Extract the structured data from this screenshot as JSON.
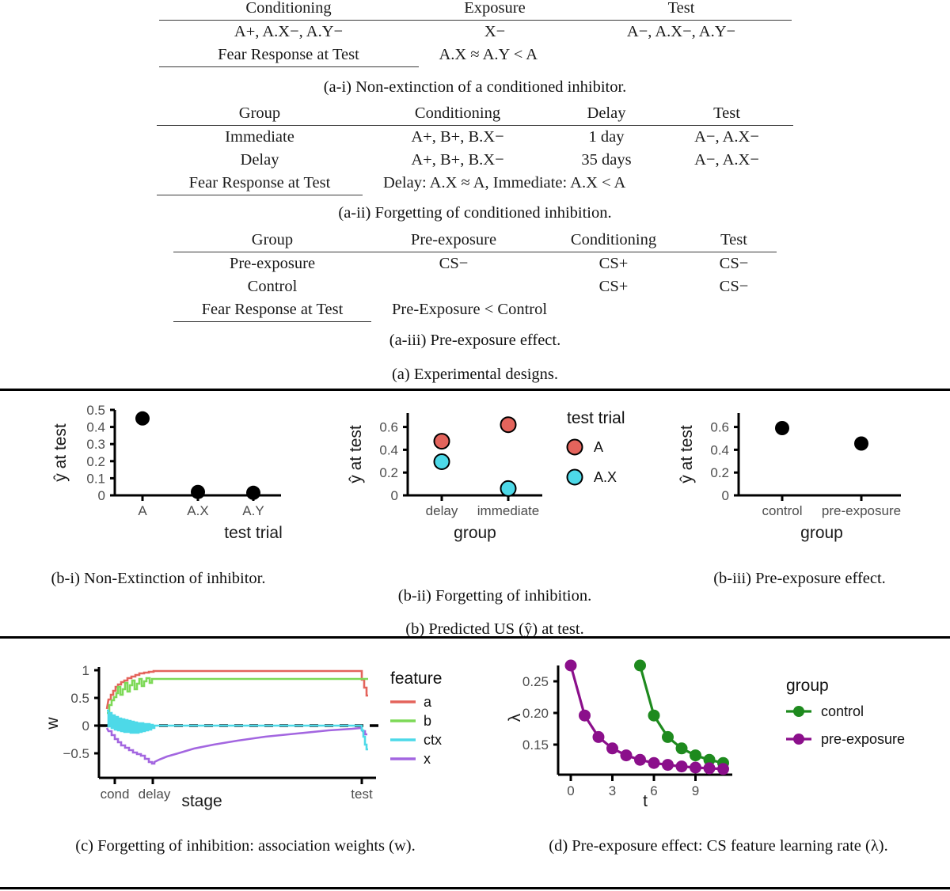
{
  "figure": {
    "sections": {
      "a_caption": "(a) Experimental designs.",
      "b_caption": "(b) Predicted US (ŷ) at test.",
      "c_caption": "(c) Forgetting of inhibition: association weights (w).",
      "d_caption": "(d) Pre-exposure effect: CS feature learning rate (λ)."
    }
  },
  "tables": {
    "a_i": {
      "caption": "(a-i) Non-extinction of a conditioned inhibitor.",
      "headers": [
        "Conditioning",
        "Exposure",
        "Test"
      ],
      "rows": [
        [
          "A+, A.X−, A.Y−",
          "X−",
          "A−, A.X−, A.Y−"
        ]
      ],
      "summary_label": "Fear Response at Test",
      "summary_value": "A.X ≈ A.Y < A"
    },
    "a_ii": {
      "caption": "(a-ii) Forgetting of conditioned inhibition.",
      "headers": [
        "Group",
        "Conditioning",
        "Delay",
        "Test"
      ],
      "rows": [
        [
          "Immediate",
          "A+, B+, B.X−",
          "1 day",
          "A−, A.X−"
        ],
        [
          "Delay",
          "A+, B+, B.X−",
          "35 days",
          "A−, A.X−"
        ]
      ],
      "summary_label": "Fear Response at Test",
      "summary_value": "Delay: A.X ≈ A, Immediate: A.X < A"
    },
    "a_iii": {
      "caption": "(a-iii) Pre-exposure effect.",
      "headers": [
        "Group",
        "Pre-exposure",
        "Conditioning",
        "Test"
      ],
      "rows": [
        [
          "Pre-exposure",
          "CS−",
          "CS+",
          "CS−"
        ],
        [
          "Control",
          "",
          "CS+",
          "CS−"
        ]
      ],
      "summary_label": "Fear Response at Test",
      "summary_value": "Pre-Exposure < Control"
    }
  },
  "captions": {
    "b_i": "(b-i) Non-Extinction of inhibitor.",
    "b_ii": "(b-ii) Forgetting of inhibition.",
    "b_iii": "(b-iii) Pre-exposure effect."
  },
  "colors": {
    "red": "#E4645C",
    "green": "#7DD957",
    "cyan": "#4DD9E8",
    "purple": "#A366E0",
    "dark_green": "#1E8A1E",
    "dark_purple": "#8B0F8B",
    "point_red": "#E4645C",
    "point_cyan": "#4DD9E8",
    "black": "#000000",
    "tick_gray": "#4d4d4d"
  },
  "chart_data": [
    {
      "id": "b-i",
      "type": "scatter",
      "title": "",
      "xlabel": "test trial",
      "ylabel": "ŷ at test",
      "categories": [
        "A",
        "A.X",
        "A.Y"
      ],
      "values": [
        0.45,
        0.02,
        0.015
      ],
      "ylim": [
        0,
        0.52
      ],
      "yticks": [
        0,
        0.1,
        0.2,
        0.3,
        0.4,
        0.5
      ],
      "ytick_labels": [
        "0",
        "0.1",
        "0.2",
        "0.3",
        "0.4",
        "0.5"
      ],
      "grid": false,
      "legend": "none",
      "point_color": "#000000"
    },
    {
      "id": "b-ii",
      "type": "scatter",
      "title": "",
      "xlabel": "group",
      "ylabel": "ŷ at test",
      "categories": [
        "delay",
        "immediate"
      ],
      "series": [
        {
          "name": "A",
          "color": "#E4645C",
          "values": [
            0.475,
            0.62
          ]
        },
        {
          "name": "A.X",
          "color": "#4DD9E8",
          "values": [
            0.295,
            0.06
          ]
        }
      ],
      "ylim": [
        0,
        0.7
      ],
      "yticks": [
        0,
        0.2,
        0.4,
        0.6
      ],
      "ytick_labels": [
        "0",
        "0.2",
        "0.4",
        "0.6"
      ],
      "grid": false,
      "legend_title": "test trial",
      "legend_position": "right"
    },
    {
      "id": "b-iii",
      "type": "scatter",
      "title": "",
      "xlabel": "group",
      "ylabel": "ŷ at test",
      "categories": [
        "control",
        "pre-exposure"
      ],
      "values": [
        0.59,
        0.455
      ],
      "ylim": [
        0,
        0.7
      ],
      "yticks": [
        0,
        0.2,
        0.4,
        0.6
      ],
      "ytick_labels": [
        "0",
        "0.2",
        "0.4",
        "0.6"
      ],
      "grid": false,
      "legend": "none",
      "point_color": "#000000"
    },
    {
      "id": "c",
      "type": "line",
      "title": "",
      "xlabel": "stage",
      "ylabel": "w",
      "xticks": [
        0,
        1,
        2
      ],
      "xtick_labels": [
        "cond",
        "delay",
        "test"
      ],
      "yticks": [
        -0.5,
        0,
        0.5,
        1
      ],
      "ytick_labels": [
        "−0.5",
        "0",
        "0.5",
        "1"
      ],
      "ylim": [
        -0.78,
        1.08
      ],
      "grid": false,
      "hline": 0,
      "legend_title": "feature",
      "legend_position": "right",
      "series": [
        {
          "name": "a",
          "color": "#E4645C",
          "start": 0.3,
          "plateau": 0.99,
          "test_end": 0.55
        },
        {
          "name": "b",
          "color": "#7DD957",
          "start": 0.22,
          "plateau": 0.84,
          "test_end": 0.84
        },
        {
          "name": "ctx",
          "color": "#4DD9E8",
          "start": 0.28,
          "plateau": 0.0,
          "test_end": -0.45
        },
        {
          "name": "x",
          "color": "#A366E0",
          "start": -0.05,
          "plateau": -0.08,
          "trough": -0.69,
          "test_end": -0.12
        }
      ]
    },
    {
      "id": "d",
      "type": "line",
      "title": "",
      "xlabel": "t",
      "ylabel": "λ",
      "xticks": [
        0,
        3,
        6,
        9
      ],
      "xtick_labels": [
        "0",
        "3",
        "6",
        "9"
      ],
      "yticks": [
        0.15,
        0.2,
        0.25
      ],
      "ytick_labels": [
        "0.15",
        "0.20",
        "0.25"
      ],
      "xlim": [
        -0.6,
        11.6
      ],
      "ylim": [
        0.108,
        0.285
      ],
      "grid": false,
      "legend_title": "group",
      "legend_position": "right",
      "series": [
        {
          "name": "control",
          "color": "#1E8A1E",
          "x": [
            5,
            6,
            7,
            8,
            9,
            10,
            11
          ],
          "y": [
            0.275,
            0.196,
            0.162,
            0.144,
            0.133,
            0.126,
            0.121
          ]
        },
        {
          "name": "pre-exposure",
          "color": "#8B0F8B",
          "x": [
            0,
            1,
            2,
            3,
            4,
            5,
            6,
            7,
            8,
            9,
            10,
            11
          ],
          "y": [
            0.275,
            0.196,
            0.162,
            0.144,
            0.133,
            0.126,
            0.1215,
            0.1185,
            0.116,
            0.1142,
            0.113,
            0.112
          ]
        }
      ]
    }
  ]
}
